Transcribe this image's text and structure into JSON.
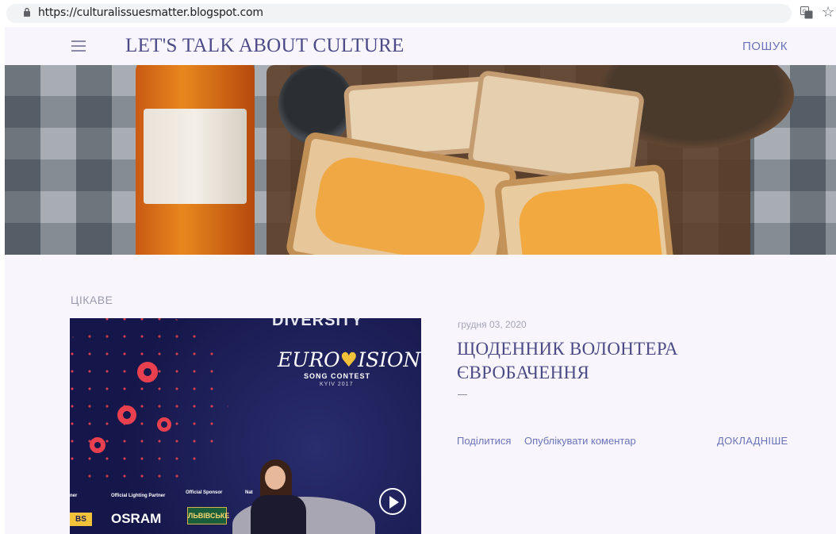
{
  "browser": {
    "url": "https://culturalissuesmatter.blogspot.com",
    "star_glyph": "☆",
    "icons": [
      "lock-icon",
      "translate-icon",
      "star-icon"
    ]
  },
  "header": {
    "title": "LET'S TALK ABOUT CULTURE",
    "search_label": "ПОШУК",
    "icons": [
      "menu-icon"
    ]
  },
  "section": {
    "label": "ЦІКАВЕ"
  },
  "post": {
    "date": "грудня 03, 2020",
    "title_line1": "ЩОДЕННИК ВОЛОНТЕРА",
    "title_line2": "ЄВРОБАЧЕННЯ",
    "share_label": "Поділитися",
    "comment_label": "Опублікувати коментар",
    "more_label": "ДОКЛАДНІШЕ",
    "image_text": {
      "diversity": "DIVERSITY",
      "logo_left": "EURO",
      "logo_heart": "♥",
      "logo_right": "ISION",
      "song_contest": "SONG CONTEST",
      "city": "KYIV 2017",
      "partner0": "ner",
      "partner1": "Official Lighting Partner",
      "partner2": "Official Sponsor",
      "partner3": "Nat",
      "osram": "OSRAM",
      "lvivske": "ЛЬВІВСЬКЕ",
      "bs": "BS"
    }
  },
  "colors": {
    "accent": "#4c4a86",
    "link": "#6b73b8",
    "muted": "#9a9aae",
    "background": "#f8f6fc"
  }
}
